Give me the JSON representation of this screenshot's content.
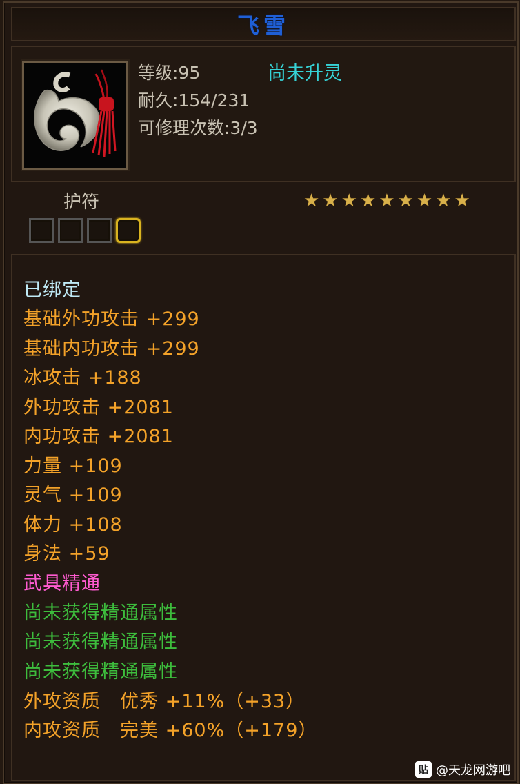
{
  "title": "飞雪",
  "item": {
    "icon": "jade-amulet-icon",
    "level_line": "等级:95",
    "durability_line": "耐久:154/231",
    "repair_line": "可修理次数:3/3",
    "spirit_status": "尚未升灵"
  },
  "type": {
    "label": "护符",
    "stars": 9,
    "gem_slots": 4
  },
  "attributes": {
    "bound": "已绑定",
    "lines": [
      "基础外功攻击 +299",
      "基础内功攻击 +299",
      "冰攻击 +188",
      "外功攻击 +2081",
      "内功攻击 +2081",
      "力量 +109",
      "灵气 +109",
      "体力 +108",
      "身法 +59"
    ],
    "mastery_title": "武具精通",
    "mastery_lines": [
      "尚未获得精通属性",
      "尚未获得精通属性",
      "尚未获得精通属性"
    ],
    "quality_lines": [
      "外攻资质　优秀 +11%（+33）",
      "内攻资质　完美 +60%（+179）"
    ]
  },
  "watermark": {
    "icon": "tieba-icon",
    "text": "@天龙网游吧"
  },
  "colors": {
    "title": "#1f5fd6",
    "spirit": "#36d2d6",
    "bound": "#bfeaf6",
    "attribute": "#f3a229",
    "mastery_title": "#ff5bd1",
    "mastery_line": "#3dbd3d",
    "star": "#d8b04a",
    "active_slot": "#d9b320"
  }
}
